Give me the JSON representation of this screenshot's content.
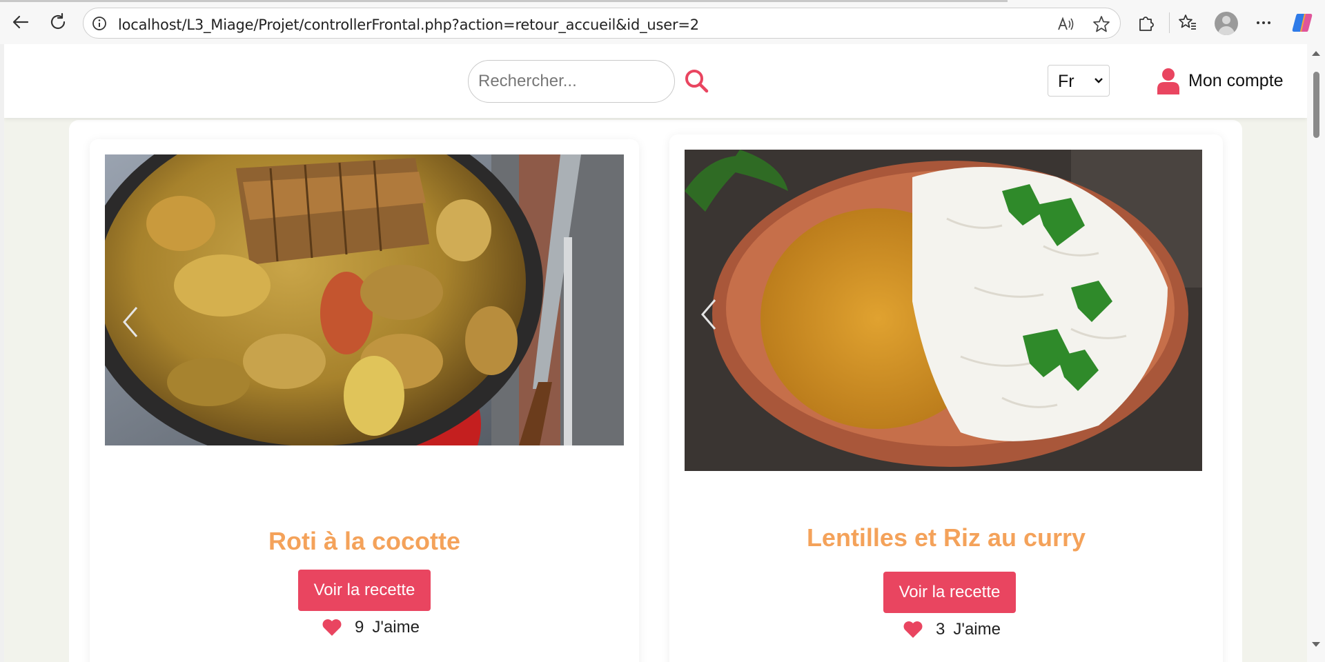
{
  "browser": {
    "url": "localhost/L3_Miage/Projet/controllerFrontal.php?action=retour_accueil&id_user=2",
    "icons": [
      "back-icon",
      "refresh-icon",
      "info-icon",
      "read-aloud-icon",
      "favorite-star-icon",
      "extensions-icon",
      "favorites-icon",
      "profile-icon",
      "more-icon",
      "copilot-icon"
    ]
  },
  "header": {
    "search_placeholder": "Rechercher...",
    "language": "Fr",
    "account_label": "Mon compte"
  },
  "recipes": [
    {
      "title": "Roti à la cocotte",
      "button_label": "Voir la recette",
      "likes": "9",
      "likes_label": "J'aime"
    },
    {
      "title": "Lentilles et Riz au curry",
      "button_label": "Voir la recette",
      "likes": "3",
      "likes_label": "J'aime"
    }
  ],
  "colors": {
    "accent": "#e94560",
    "title": "#f4a25a",
    "page_background": "#f2f3ec"
  }
}
